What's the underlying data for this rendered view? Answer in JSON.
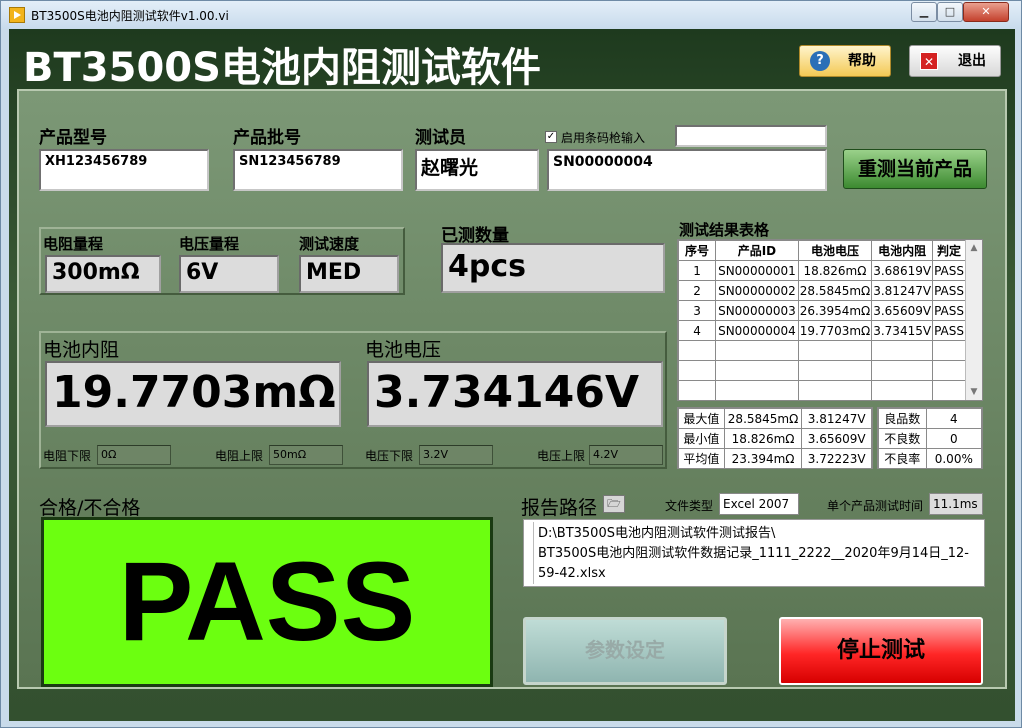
{
  "window": {
    "title": "BT3500S电池内阻测试软件v1.00.vi",
    "min": "▁",
    "max": "□",
    "close": "✕"
  },
  "header": {
    "title": "BT3500S电池内阻测试软件",
    "help_label": "帮助",
    "help_icon": "?",
    "exit_label": "退出",
    "exit_icon": "✕"
  },
  "product": {
    "model_label": "产品型号",
    "model_value": "XH123456789",
    "batch_label": "产品批号",
    "batch_value": "SN123456789",
    "tester_label": "测试员",
    "tester_value": "赵曙光",
    "barcode_checkbox_label": "启用条码枪输入",
    "barcode_checked": true,
    "barcode_input": "",
    "sn_value": "SN00000004",
    "retest_label": "重测当前产品"
  },
  "ranges": {
    "resistance_label": "电阻量程",
    "resistance_value": "300mΩ",
    "voltage_label": "电压量程",
    "voltage_value": "6V",
    "speed_label": "测试速度",
    "speed_value": "MED"
  },
  "count": {
    "label": "已测数量",
    "value": "4pcs"
  },
  "readings": {
    "resistance_label": "电池内阻",
    "resistance_value": "19.7703mΩ",
    "voltage_label": "电池电压",
    "voltage_value": "3.734146V",
    "r_low_label": "电阻下限",
    "r_low_value": "0Ω",
    "r_high_label": "电阻上限",
    "r_high_value": "50mΩ",
    "v_low_label": "电压下限",
    "v_low_value": "3.2V",
    "v_high_label": "电压上限",
    "v_high_value": "4.2V"
  },
  "results": {
    "title": "测试结果表格",
    "columns": [
      "序号",
      "产品ID",
      "电池电压",
      "电池内阻",
      "判定"
    ],
    "rows": [
      [
        "1",
        "SN00000001",
        "18.826mΩ",
        "3.68619V",
        "PASS"
      ],
      [
        "2",
        "SN00000002",
        "28.5845mΩ",
        "3.81247V",
        "PASS"
      ],
      [
        "3",
        "SN00000003",
        "26.3954mΩ",
        "3.65609V",
        "PASS"
      ],
      [
        "4",
        "SN00000004",
        "19.7703mΩ",
        "3.73415V",
        "PASS"
      ]
    ]
  },
  "stats": {
    "rows": [
      [
        "最大值",
        "28.5845mΩ",
        "3.81247V"
      ],
      [
        "最小值",
        "18.826mΩ",
        "3.65609V"
      ],
      [
        "平均值",
        "23.394mΩ",
        "3.72223V"
      ]
    ],
    "quality": [
      [
        "良品数",
        "4"
      ],
      [
        "不良数",
        "0"
      ],
      [
        "不良率",
        "0.00%"
      ]
    ]
  },
  "verdict": {
    "label": "合格/不合格",
    "value": "PASS",
    "color": "#6cff10"
  },
  "report": {
    "label": "报告路径",
    "folder_icon": "🗁",
    "filetype_label": "文件类型",
    "filetype_value": "Excel 2007",
    "time_label": "单个产品测试时间",
    "time_value": "11.1ms",
    "path_line1": "D:\\BT3500S电池内阻测试软件测试报告\\",
    "path_line2": "BT3500S电池内阻测试软件数据记录_1111_2222__2020年9月14日_12-",
    "path_line3": "59-42.xlsx"
  },
  "buttons": {
    "params_label": "参数设定",
    "stop_label": "停止测试"
  }
}
